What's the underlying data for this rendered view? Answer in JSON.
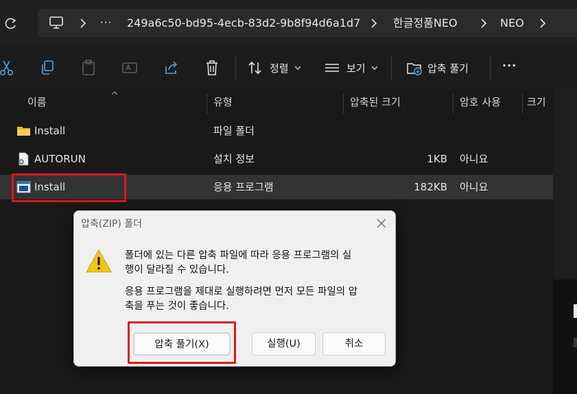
{
  "address": {
    "overflow": "···",
    "crumbs": [
      "249a6c50-bd95-4ecb-83d2-9b8f94d6a1d7",
      "한글정품NEO",
      "NEO"
    ]
  },
  "toolbar": {
    "sort_label": "정렬",
    "view_label": "보기",
    "extract_all_label": "압축 풀기",
    "more_label": "···"
  },
  "columns": {
    "name": "이름",
    "type": "유형",
    "compressed_size": "압축된 크기",
    "password": "암호 사용",
    "size": "크기"
  },
  "files": [
    {
      "name": "Install",
      "type": "파일 폴더",
      "compressed_size": "",
      "password": "",
      "icon": "folder-icon"
    },
    {
      "name": "AUTORUN",
      "type": "설치 정보",
      "compressed_size": "1KB",
      "password": "아니요",
      "icon": "setup-info-icon"
    },
    {
      "name": "Install",
      "type": "응용 프로그램",
      "compressed_size": "182KB",
      "password": "아니요",
      "icon": "application-icon"
    }
  ],
  "dialog": {
    "title": "압축(ZIP) 폴더",
    "message1_line1": "폴더에 있는 다른 압축 파일에 따라 응용 프로그램의 실",
    "message1_line2": "행이 달라질 수 있습니다.",
    "message2_line1": "응용 프로그램을 제대로 실행하려면 먼저 모든 파일의 압",
    "message2_line2": "축을 푸는 것이 좋습니다.",
    "extract_button": "압축 풀기(X)",
    "run_button": "실행(U)",
    "cancel_button": "취소"
  },
  "colors": {
    "highlight": "#e0141e",
    "background": "#191919",
    "dialog_bg": "#f0f0f0"
  }
}
